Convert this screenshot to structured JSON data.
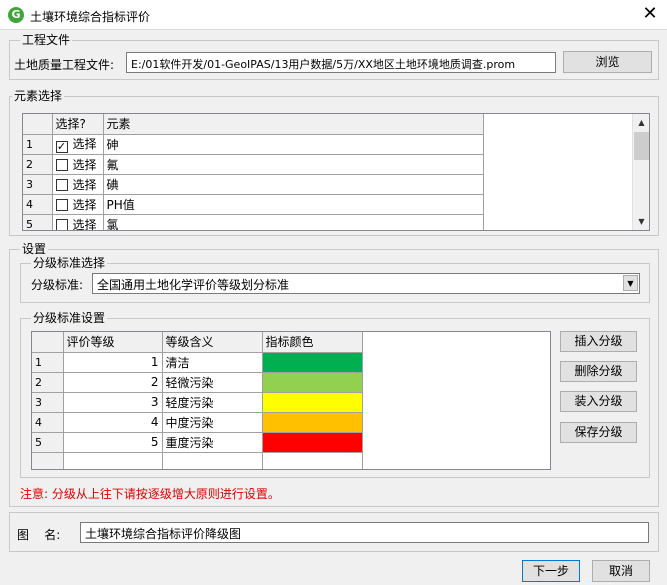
{
  "window": {
    "title": "土壤环境综合指标评价",
    "app_icon_letter": "G",
    "close_symbol": "✕"
  },
  "project": {
    "group_label": "工程文件",
    "file_label": "土地质量工程文件:",
    "file_path": "E:/01软件开发/01-GeoIPAS/13用户数据/5万/XX地区土地环境地质调查.prom",
    "browse_label": "浏览"
  },
  "elements": {
    "group_label": "元素选择",
    "columns": [
      "选择?",
      "元素"
    ],
    "rows": [
      {
        "index": "1",
        "checked": true,
        "check_label": "选择",
        "name": "砷"
      },
      {
        "index": "2",
        "checked": false,
        "check_label": "选择",
        "name": "氟"
      },
      {
        "index": "3",
        "checked": false,
        "check_label": "选择",
        "name": "碘"
      },
      {
        "index": "4",
        "checked": false,
        "check_label": "选择",
        "name": "PH值"
      },
      {
        "index": "5",
        "checked": false,
        "check_label": "选择",
        "name": "氯"
      }
    ]
  },
  "settings": {
    "group_label": "设置",
    "standard_group_label": "分级标准选择",
    "standard_label": "分级标准:",
    "standard_value": "全国通用土地化学评价等级划分标准",
    "grading_group_label": "分级标准设置",
    "grading_columns": [
      "评价等级",
      "等级含义",
      "指标颜色"
    ],
    "grading_rows": [
      {
        "index": "1",
        "level": "1",
        "meaning": "清洁",
        "color": "#00b050"
      },
      {
        "index": "2",
        "level": "2",
        "meaning": "轻微污染",
        "color": "#92d050"
      },
      {
        "index": "3",
        "level": "3",
        "meaning": "轻度污染",
        "color": "#ffff00"
      },
      {
        "index": "4",
        "level": "4",
        "meaning": "中度污染",
        "color": "#ffc000"
      },
      {
        "index": "5",
        "level": "5",
        "meaning": "重度污染",
        "color": "#ff0000"
      }
    ],
    "buttons": {
      "insert": "插入分级",
      "delete": "删除分级",
      "load": "装入分级",
      "save": "保存分级"
    },
    "note": "注意: 分级从上往下请按逐级增大原则进行设置。"
  },
  "map_name": {
    "label": "图    名:",
    "value": "土壤环境综合指标评价降级图"
  },
  "footer": {
    "next_label": "下一步",
    "cancel_label": "取消"
  }
}
